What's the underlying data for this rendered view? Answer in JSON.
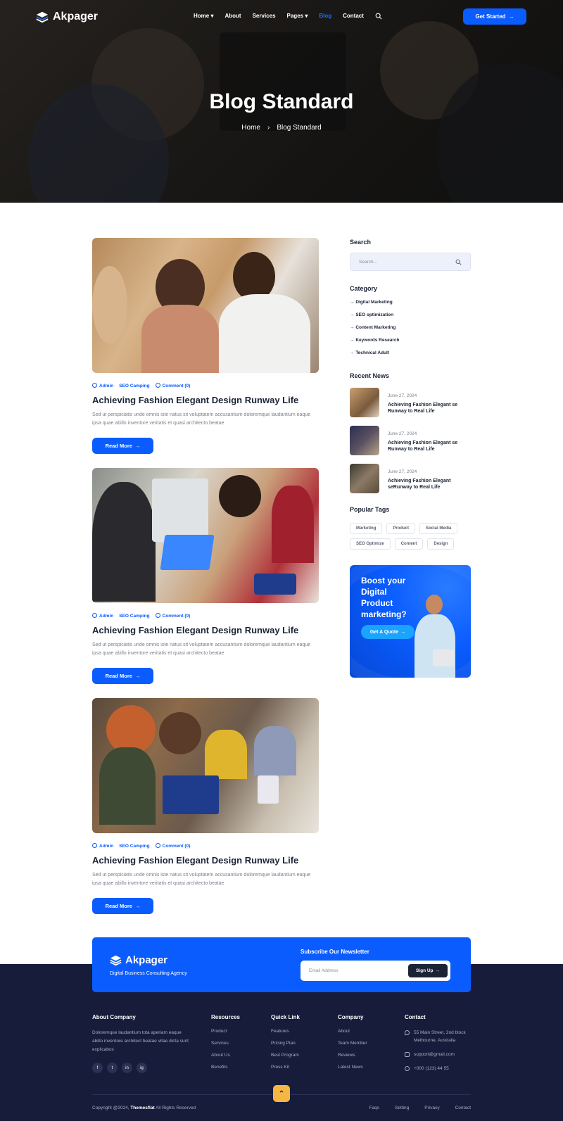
{
  "brand": {
    "name": "Akpager",
    "accent": "#0a5cff",
    "dark": "#161c3a",
    "tagline": "Digital Business Consulting Agency"
  },
  "nav": {
    "items": [
      {
        "label": "Home",
        "dropdown": true
      },
      {
        "label": "About",
        "dropdown": false
      },
      {
        "label": "Services",
        "dropdown": false
      },
      {
        "label": "Pages",
        "dropdown": true
      },
      {
        "label": "Blog",
        "dropdown": false,
        "active": true
      },
      {
        "label": "Contact",
        "dropdown": false
      }
    ],
    "cta": "Get Started"
  },
  "hero": {
    "title": "Blog Standard",
    "breadcrumb": [
      "Home",
      "Blog Standard"
    ]
  },
  "posts": [
    {
      "author": "Admin",
      "category": "SEO Camping",
      "comments": "Comment (0)",
      "title": "Achieving Fashion Elegant Design Runway Life",
      "excerpt": "Sed ut perspiciatis unde omnis iste natus sit voluptatem accusantium doloremque laudantium eaque ipsa quae abillo inventore veritatis et quasi architecto beatae",
      "button": "Read More"
    },
    {
      "author": "Admin",
      "category": "SEO Camping",
      "comments": "Comment (0)",
      "title": "Achieving Fashion Elegant Design Runway Life",
      "excerpt": "Sed ut perspiciatis unde omnis iste natus sit voluptatem accusantium doloremque laudantium eaque ipsa quae abillo inventore veritatis et quasi architecto beatae",
      "button": "Read More"
    },
    {
      "author": "Admin",
      "category": "SEO Camping",
      "comments": "Comment (0)",
      "title": "Achieving Fashion Elegant Design Runway Life",
      "excerpt": "Sed ut perspiciatis unde omnis iste natus sit voluptatem accusantium doloremque laudantium eaque ipsa quae abillo inventore veritatis et quasi architecto beatae",
      "button": "Read More"
    }
  ],
  "sidebar": {
    "search": {
      "title": "Search",
      "placeholder": "Search..."
    },
    "category": {
      "title": "Category",
      "items": [
        "Digital Marketing",
        "SEO optimization",
        "Content Marketing",
        "Keywords Research",
        "Technical Adult"
      ]
    },
    "recent": {
      "title": "Recent News",
      "items": [
        {
          "date": "June 27, 2024",
          "title": "Achieving Fashion Elegant se Runway to Real Life"
        },
        {
          "date": "June 27, 2024",
          "title": "Achieving Fashion Elegant se Runway to Real Life"
        },
        {
          "date": "June 27, 2024",
          "title": "Achieving Fashion Elegant seRunway to Real Life"
        }
      ]
    },
    "tags": {
      "title": "Popular Tags",
      "items": [
        "Marketing",
        "Product",
        "Social Media",
        "SEO Optimize",
        "Content",
        "Design"
      ]
    },
    "promo": {
      "text": "Boost your Digital Product marketing?",
      "button": "Get A Quote"
    }
  },
  "newsletter": {
    "title": "Subscribe Our Newsletter",
    "placeholder": "Email Address",
    "button": "Sign Up"
  },
  "footer": {
    "about": {
      "title": "About Company",
      "text": "Doloremque laudantium tota aperiam eaque abillo inventore architect beatae vitae dicta sunt explicabos",
      "socials": [
        "f",
        "t",
        "in",
        "ig"
      ]
    },
    "resources": {
      "title": "Resources",
      "links": [
        "Product",
        "Services",
        "About Us",
        "Benefits"
      ]
    },
    "quick": {
      "title": "Quick Link",
      "links": [
        "Features",
        "Pricing Plan",
        "Best Program",
        "Press Kit"
      ]
    },
    "company": {
      "title": "Company",
      "links": [
        "About",
        "Team Member",
        "Reviews",
        "Latest News"
      ]
    },
    "contact": {
      "title": "Contact",
      "address": "55 Main Street, 2nd block Melbourne, Australia",
      "email": "support@gmail.com",
      "phone": "+000 (123) 44 55"
    },
    "copyright_prefix": "Copyright @2024,",
    "copyright_brand": "Themesflat",
    "copyright_suffix": "All Rights Reserved",
    "bottom_links": [
      "Faqs",
      "Setting",
      "Privacy",
      "Contact"
    ]
  }
}
